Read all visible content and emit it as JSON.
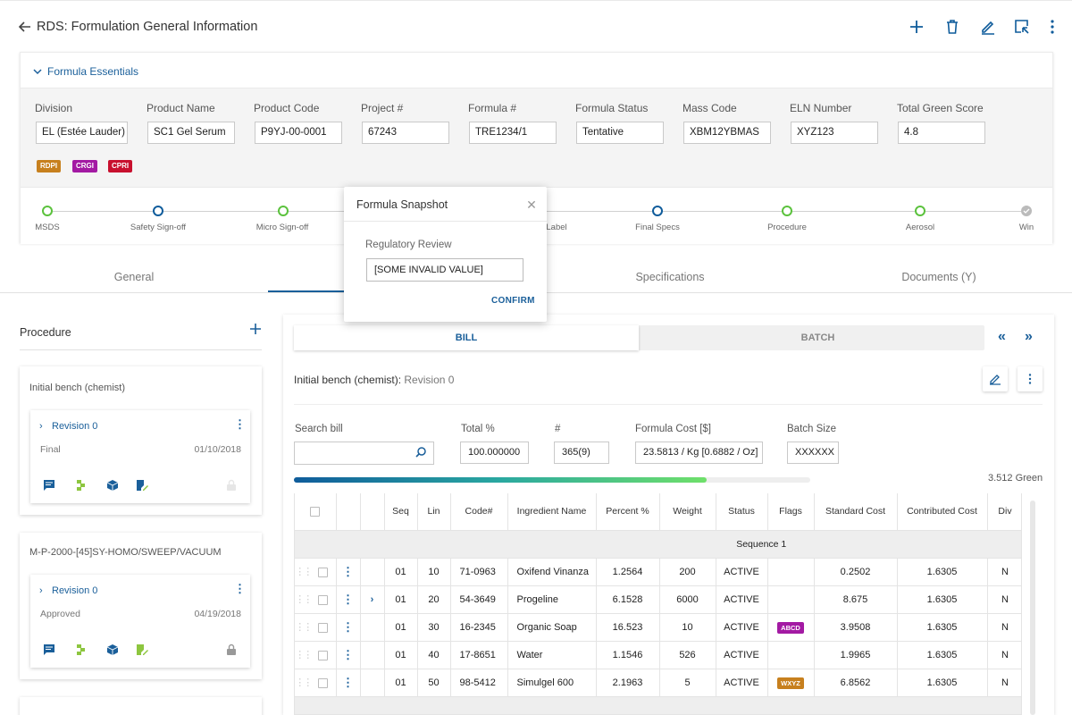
{
  "header": {
    "title": "RDS: Formulation General Information"
  },
  "essentials": {
    "title": "Formula Essentials",
    "fields": [
      {
        "label": "Division",
        "value": "EL (Estée Lauder)"
      },
      {
        "label": "Product Name",
        "value": "SC1 Gel Serum"
      },
      {
        "label": "Product Code",
        "value": "P9YJ-00-0001"
      },
      {
        "label": "Project #",
        "value": "67243"
      },
      {
        "label": "Formula #",
        "value": "TRE1234/1"
      },
      {
        "label": "Formula Status",
        "value": "Tentative"
      },
      {
        "label": "Mass Code",
        "value": "XBM12YBMAS"
      },
      {
        "label": "ELN Number",
        "value": "XYZ123"
      },
      {
        "label": "Total Green Score",
        "value": "4.8"
      }
    ],
    "badges": [
      {
        "text": "RDPI",
        "color": "#c7801e"
      },
      {
        "text": "CRGI",
        "color": "#a31aa3"
      },
      {
        "text": "CPRI",
        "color": "#c8102e"
      }
    ],
    "steps": [
      {
        "label": "MSDS",
        "color": "#5bc23d"
      },
      {
        "label": "Safety Sign-off",
        "color": "#0f5c9b"
      },
      {
        "label": "Micro Sign-off",
        "color": "#5bc23d"
      },
      {
        "label": "Label",
        "color": "#5bc23d"
      },
      {
        "label": "Final Specs",
        "color": "#0f5c9b"
      },
      {
        "label": "Procedure",
        "color": "#5bc23d"
      },
      {
        "label": "Aerosol",
        "color": "#5bc23d"
      },
      {
        "label": "Win",
        "color": "#bbbbbb"
      }
    ]
  },
  "tabs": [
    "General",
    "Specifications",
    "Documents (Y)"
  ],
  "popup": {
    "title": "Formula Snapshot",
    "field_label": "Regulatory Review",
    "field_value": "[SOME INVALID VALUE]",
    "confirm": "CONFIRM"
  },
  "procedure": {
    "title": "Procedure",
    "cards": [
      {
        "title": "Initial bench (chemist)",
        "revision": "Revision 0",
        "status": "Final",
        "date": "01/10/2018"
      },
      {
        "title": "M-P-2000-[45]SY-HOMO/SWEEP/VACUUM",
        "revision": "Revision 0",
        "status": "Approved",
        "date": "04/19/2018"
      }
    ]
  },
  "bill": {
    "toggle_bill": "BILL",
    "toggle_batch": "BATCH",
    "bench_title": "Initial bench (chemist):",
    "bench_revision": "Revision 0",
    "search_label": "Search bill",
    "total_label": "Total %",
    "total_value": "100.000000",
    "count_label": "#",
    "count_value": "365(9)",
    "cost_label": "Formula Cost [$]",
    "cost_value": "23.5813 / Kg [0.6882 / Oz]",
    "batch_label": "Batch Size",
    "batch_value": "XXXXXX",
    "green_text": "3.512 Green",
    "progress": 0.8
  },
  "table": {
    "columns": [
      "Seq",
      "Lin",
      "Code#",
      "Ingredient Name",
      "Percent %",
      "Weight",
      "Status",
      "Flags",
      "Standard Cost",
      "Contributed Cost",
      "Div"
    ],
    "sequence_label": "Sequence 1",
    "rows": [
      {
        "seq": "01",
        "lin": "10",
        "code": "71-0963",
        "name": "Oxifend Vinanza",
        "percent": "1.2564",
        "weight": "200",
        "status": "ACTIVE",
        "flag": "",
        "flag_color": "",
        "std": "0.2502",
        "contrib": "1.6305",
        "div": "N",
        "expand": false
      },
      {
        "seq": "01",
        "lin": "20",
        "code": "54-3649",
        "name": "Progeline",
        "percent": "6.1528",
        "weight": "6000",
        "status": "ACTIVE",
        "flag": "",
        "flag_color": "",
        "std": "8.675",
        "contrib": "1.6305",
        "div": "N",
        "expand": true
      },
      {
        "seq": "01",
        "lin": "30",
        "code": "16-2345",
        "name": "Organic Soap",
        "percent": "16.523",
        "weight": "10",
        "status": "ACTIVE",
        "flag": "ABCD",
        "flag_color": "#a31aa3",
        "std": "3.9508",
        "contrib": "1.6305",
        "div": "N",
        "expand": false
      },
      {
        "seq": "01",
        "lin": "40",
        "code": "17-8651",
        "name": "Water",
        "percent": "1.1546",
        "weight": "526",
        "status": "ACTIVE",
        "flag": "",
        "flag_color": "",
        "std": "1.9965",
        "contrib": "1.6305",
        "div": "N",
        "expand": false
      },
      {
        "seq": "01",
        "lin": "50",
        "code": "98-5412",
        "name": "Simulgel 600",
        "percent": "2.1963",
        "weight": "5",
        "status": "ACTIVE",
        "flag": "WXYZ",
        "flag_color": "#c7801e",
        "std": "6.8562",
        "contrib": "1.6305",
        "div": "N",
        "expand": false
      }
    ]
  }
}
